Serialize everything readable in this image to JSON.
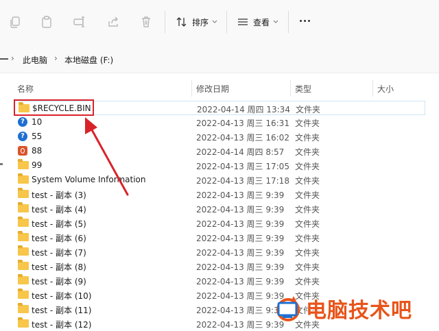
{
  "toolbar": {
    "sort_label": "排序",
    "view_label": "查看",
    "icons": [
      "copy-icon",
      "paste-icon",
      "rename-icon",
      "share-icon",
      "delete-icon",
      "sort-icon",
      "view-icon",
      "more-icon"
    ]
  },
  "breadcrumb": {
    "items": [
      "此电脑",
      "本地磁盘 (F:)"
    ],
    "separator": "›"
  },
  "columns": {
    "name": "名称",
    "date": "修改日期",
    "type": "类型",
    "size": "大小"
  },
  "rows": [
    {
      "name": "$RECYCLE.BIN",
      "date": "2022-04-14 周四 13:34",
      "type": "文件夹",
      "icon": "folder-icon"
    },
    {
      "name": "10",
      "date": "2022-04-13 周三 16:31",
      "type": "文件夹",
      "icon": "help-icon"
    },
    {
      "name": "55",
      "date": "2022-04-13 周三 16:02",
      "type": "文件夹",
      "icon": "help-icon"
    },
    {
      "name": "88",
      "date": "2022-04-14 周四 8:57",
      "type": "文件夹",
      "icon": "power-app-icon"
    },
    {
      "name": "99",
      "date": "2022-04-13 周三 17:05",
      "type": "文件夹",
      "icon": "folder-icon"
    },
    {
      "name": "System Volume Information",
      "date": "2022-04-13 周三 17:18",
      "type": "文件夹",
      "icon": "folder-icon"
    },
    {
      "name": "test - 副本 (3)",
      "date": "2022-04-13 周三 9:39",
      "type": "文件夹",
      "icon": "folder-icon"
    },
    {
      "name": "test - 副本 (4)",
      "date": "2022-04-13 周三 9:39",
      "type": "文件夹",
      "icon": "folder-icon"
    },
    {
      "name": "test - 副本 (5)",
      "date": "2022-04-13 周三 9:39",
      "type": "文件夹",
      "icon": "folder-icon"
    },
    {
      "name": "test - 副本 (6)",
      "date": "2022-04-13 周三 9:39",
      "type": "文件夹",
      "icon": "folder-icon"
    },
    {
      "name": "test - 副本 (7)",
      "date": "2022-04-13 周三 9:39",
      "type": "文件夹",
      "icon": "folder-icon"
    },
    {
      "name": "test - 副本 (8)",
      "date": "2022-04-13 周三 9:39",
      "type": "文件夹",
      "icon": "folder-icon"
    },
    {
      "name": "test - 副本 (9)",
      "date": "2022-04-13 周三 9:39",
      "type": "文件夹",
      "icon": "folder-icon"
    },
    {
      "name": "test - 副本 (10)",
      "date": "2022-04-13 周三 9:39",
      "type": "文件夹",
      "icon": "folder-icon"
    },
    {
      "name": "test - 副本 (11)",
      "date": "2022-04-13 周三 9:39",
      "type": "文件夹",
      "icon": "folder-icon"
    },
    {
      "name": "test - 副本 (12)",
      "date": "2022-04-13 周三 9:39",
      "type": "文件夹",
      "icon": "folder-icon"
    }
  ],
  "annotation": {
    "highlight_color": "#d8232a"
  },
  "watermark": {
    "text": "电脑技术吧",
    "color": "#e8541a"
  }
}
